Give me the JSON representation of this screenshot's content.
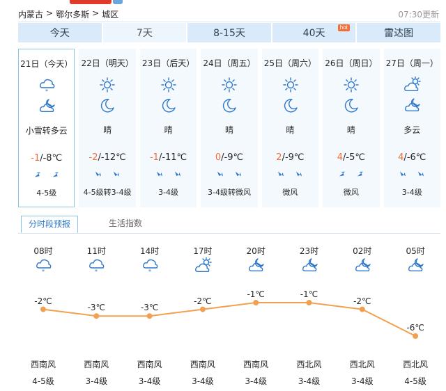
{
  "breadcrumb": [
    "内蒙古",
    ">",
    "鄂尔多斯",
    ">",
    "城区"
  ],
  "pub_time": "07:30更新",
  "tabs": [
    {
      "label": "今天",
      "active": false
    },
    {
      "label": "7天",
      "active": true
    },
    {
      "label": "8-15天",
      "active": false
    },
    {
      "label": "40天",
      "active": false,
      "badge": "hot"
    },
    {
      "label": "雷达图",
      "active": false
    }
  ],
  "days": [
    {
      "date": "21日（今天）",
      "icon_day": "snow-cloud-icon",
      "icon_night": "cloudy-night-icon",
      "desc": "小雪转多云",
      "high": "-1",
      "low": "-8℃",
      "wind_icons": [
        "wind-northeast-icon",
        "wind-northeast-icon"
      ],
      "wind_level": "4-5级",
      "today": true
    },
    {
      "date": "22日（明天）",
      "icon_day": "sun-icon",
      "icon_night": "moon-icon",
      "desc": "晴",
      "high": "-2",
      "low": "-12℃",
      "wind_icons": [
        "wind-southwest-icon",
        "wind-southwest-icon"
      ],
      "wind_level": "4-5级转3-4级"
    },
    {
      "date": "23日（后天）",
      "icon_day": "sun-icon",
      "icon_night": "moon-icon",
      "desc": "晴",
      "high": "-1",
      "low": "-11℃",
      "wind_icons": [
        "wind-southwest-icon",
        "wind-southwest-icon"
      ],
      "wind_level": "3-4级"
    },
    {
      "date": "24日（周五）",
      "icon_day": "sun-icon",
      "icon_night": "moon-icon",
      "desc": "晴",
      "high": "0",
      "low": "-9℃",
      "wind_icons": [
        "wind-southwest-icon",
        "wind-southwest-icon"
      ],
      "wind_level": "3-4级转微风"
    },
    {
      "date": "25日（周六）",
      "icon_day": "sun-icon",
      "icon_night": "moon-icon",
      "desc": "晴",
      "high": "2",
      "low": "-9℃",
      "wind_icons": [
        "wind-southwest-icon",
        "wind-southwest-icon"
      ],
      "wind_level": "微风"
    },
    {
      "date": "26日（周日）",
      "icon_day": "sun-icon",
      "icon_night": "moon-icon",
      "desc": "晴",
      "high": "4",
      "low": "-5℃",
      "wind_icons": [
        "wind-northeast-icon",
        "wind-northeast-icon"
      ],
      "wind_level": "微风"
    },
    {
      "date": "27日（周一）",
      "icon_day": "partly-cloudy-icon",
      "icon_night": "cloudy-night-icon",
      "desc": "多云",
      "high": "4",
      "low": "-6℃",
      "wind_icons": [
        "wind-southwest-icon",
        "wind-southwest-icon"
      ],
      "wind_level": "3-4级"
    }
  ],
  "subtabs": {
    "hourly": "分时段预报",
    "index": "生活指数"
  },
  "colors": {
    "tab_bg": "#d9ebfa",
    "accent": "#f46e3a",
    "link": "#2f77c8",
    "border": "#8ec3ea"
  },
  "chart_data": {
    "type": "line",
    "x": [
      "08时",
      "11时",
      "14时",
      "17时",
      "20时",
      "23时",
      "02时",
      "05时"
    ],
    "series": [
      {
        "values": [
          -2,
          -3,
          -3,
          -2,
          -1,
          -1,
          -2,
          -6
        ]
      }
    ],
    "point_labels": [
      "-2℃",
      "-3℃",
      "-3℃",
      "-2℃",
      "-1℃",
      "-1℃",
      "-2℃",
      "-6℃"
    ],
    "icons": [
      "snow-cloud-icon",
      "snow-cloud-icon",
      "snow-cloud-icon",
      "partly-cloudy-icon",
      "cloudy-night-icon",
      "cloudy-night-icon",
      "cloudy-night-icon",
      "cloudy-night-icon"
    ],
    "wind_dir": [
      "西南风",
      "西南风",
      "西南风",
      "西南风",
      "西南风",
      "西北风",
      "西北风",
      "西北风"
    ],
    "wind_level": [
      "4-5级",
      "3-4级",
      "3-4级",
      "3-4级",
      "3-4级",
      "3-4级",
      "3-4级",
      "4-5级"
    ],
    "ylim": [
      -6,
      -1
    ],
    "grid": false
  }
}
